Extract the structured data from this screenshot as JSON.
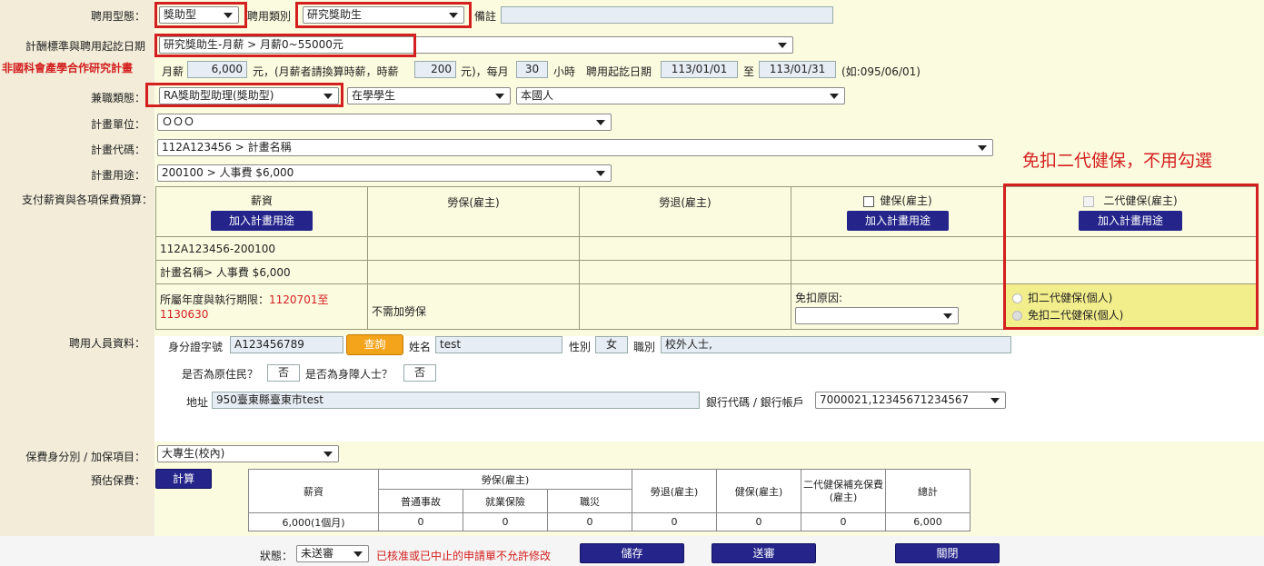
{
  "hire_type": {
    "label": "聘用型態：",
    "value": "獎助型"
  },
  "hire_category": {
    "label": "聘用類別",
    "value": "研究獎助生"
  },
  "remark": {
    "label": "備註",
    "value": ""
  },
  "salary_standard": {
    "label": "計酬標準與聘用起訖日期",
    "value": "研究獎助生-月薪 > 月薪0~55000元"
  },
  "non_nstc_note": "非國科會產學合作研究計畫",
  "salary_row": {
    "monthly_label": "月薪",
    "monthly_value": "6,000",
    "unit_text": "元，(月薪者請換算時薪，時薪",
    "hourly_value": "200",
    "per_month_text": "元)，每月",
    "hours_value": "30",
    "hours_unit": "小時",
    "start_label": "聘用起訖日期",
    "start_date": "113/01/01",
    "to_label": "至",
    "end_date": "113/01/31",
    "example": "(如:095/06/01)"
  },
  "parttime": {
    "label": "兼職類態：",
    "type": "RA獎助型助理(獎助型)",
    "status": "在學學生",
    "nationality": "本國人"
  },
  "plan_unit": {
    "label": "計畫單位：",
    "value": "ＯＯＯ"
  },
  "plan_code": {
    "label": "計畫代碼：",
    "value": "112A123456 > 計畫名稱"
  },
  "plan_use": {
    "label": "計畫用途：",
    "value": "200100 > 人事費 $6,000"
  },
  "budget": {
    "label": "支付薪資與各項保費預算：",
    "col_salary": "薪資",
    "col_labor": "勞保(雇主)",
    "col_pension": "勞退(雇主)",
    "col_health": "健保(雇主)",
    "col_nhi2": "二代健保(雇主)",
    "add_button": "加入計畫用途",
    "row_code": "112A123456-200100",
    "row_name": "計畫名稱> 人事費 $6,000",
    "period_label": "所屬年度與執行期限：",
    "period_value": "1120701至1130630",
    "no_labor": "不需加勞保",
    "exempt_reason": "免扣原因:",
    "nhi_deduct": "扣二代健保(個人)",
    "nhi_exempt": "免扣二代健保(個人)"
  },
  "annotation": "免扣二代健保，不用勾選",
  "person": {
    "label": "聘用人員資料：",
    "id_label": "身分證字號",
    "id_value": "A123456789",
    "query_button": "查詢",
    "name_label": "姓名",
    "name_value": "test",
    "gender_label": "性別",
    "gender_value": "女",
    "job_label": "職別",
    "job_value": "校外人士,",
    "aboriginal_label": "是否為原住民？",
    "aboriginal_value": "否",
    "disabled_label": "是否為身障人士？",
    "disabled_value": "否",
    "address_label": "地址",
    "address_value": "950臺東縣臺東市test",
    "bank_label": "銀行代碼 / 銀行帳戶",
    "bank_value": "7000021,12345671234567"
  },
  "insurance_identity": {
    "label": "保費身分別 / 加保項目：",
    "value": "大專生(校內)"
  },
  "estimate": {
    "label": "預估保費：",
    "calc_button": "計算",
    "headers": {
      "salary": "薪資",
      "labor": "勞保(雇主)",
      "ordinary": "普通事故",
      "employment": "就業保險",
      "occupational": "職災",
      "pension": "勞退(雇主)",
      "health": "健保(雇主)",
      "nhi2": "二代健保補充保費(雇主)",
      "total": "總計"
    },
    "values": {
      "salary": "6,000(1個月)",
      "ordinary": "0",
      "employment": "0",
      "occupational": "0",
      "pension": "0",
      "health": "0",
      "nhi2": "0",
      "total": "6,000"
    }
  },
  "footer": {
    "status_label": "狀態：",
    "status_value": "未送審",
    "warning": "已核准或已中止的申請單不允許修改",
    "save_button": "儲存",
    "submit_button": "送審",
    "close_button": "關閉"
  }
}
